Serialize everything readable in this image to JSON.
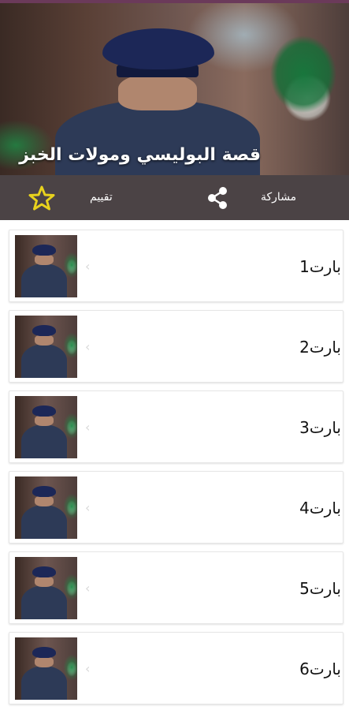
{
  "header": {
    "title": "قصة البوليسي ومولات الخبز"
  },
  "actions": {
    "share_label": "مشاركة",
    "rate_label": "تقييم",
    "share_icon": "share-icon",
    "rate_icon": "star-outline-icon",
    "star_color": "#e8d21d"
  },
  "items": [
    {
      "label": "بارت1"
    },
    {
      "label": "بارت2"
    },
    {
      "label": "بارت3"
    },
    {
      "label": "بارت4"
    },
    {
      "label": "بارت5"
    },
    {
      "label": "بارت6"
    }
  ]
}
